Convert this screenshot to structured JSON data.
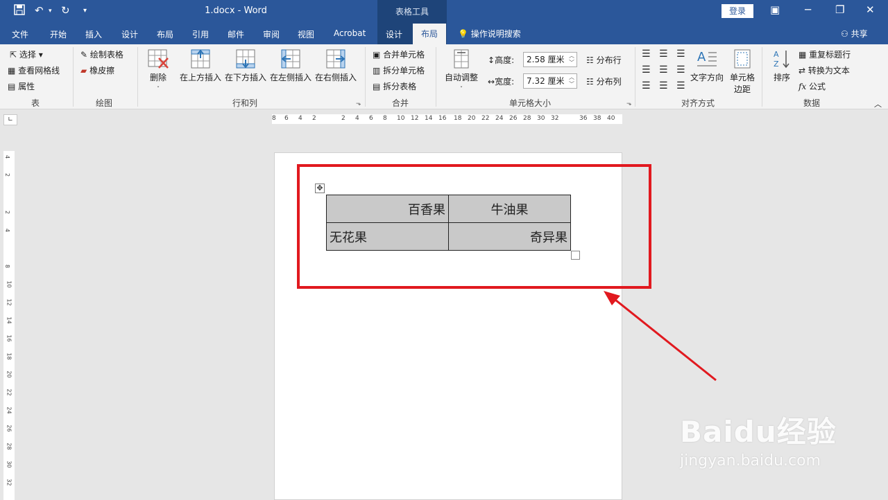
{
  "window": {
    "doc_title": "1.docx  -  Word",
    "context_tools": "表格工具",
    "login": "登录"
  },
  "tabs": [
    "文件",
    "开始",
    "插入",
    "设计",
    "布局",
    "引用",
    "邮件",
    "审阅",
    "视图",
    "Acrobat",
    "设计",
    "布局"
  ],
  "tell_me": "操作说明搜索",
  "share": "共享",
  "ribbon": {
    "table_group": {
      "label": "表",
      "select": "选择",
      "gridlines": "查看网格线",
      "properties": "属性"
    },
    "draw_group": {
      "label": "绘图",
      "draw_table": "绘制表格",
      "eraser": "橡皮擦"
    },
    "rows_group": {
      "label": "行和列",
      "delete": "删除",
      "insert_above": "在上方插入",
      "insert_below": "在下方插入",
      "insert_left": "在左侧插入",
      "insert_right": "在右侧插入"
    },
    "merge_group": {
      "label": "合并",
      "merge_cells": "合并单元格",
      "split_cells": "拆分单元格",
      "split_table": "拆分表格"
    },
    "cellsize_group": {
      "label": "单元格大小",
      "autofit": "自动调整",
      "height_label": "高度:",
      "height_value": "2.58 厘米",
      "width_label": "宽度:",
      "width_value": "7.32 厘米",
      "distribute_rows": "分布行",
      "distribute_cols": "分布列"
    },
    "align_group": {
      "label": "对齐方式",
      "text_direction": "文字方向",
      "cell_margins_1": "单元格",
      "cell_margins_2": "边距"
    },
    "data_group": {
      "label": "数据",
      "sort": "排序",
      "repeat_header": "重复标题行",
      "convert_text": "转换为文本",
      "formula": "公式"
    }
  },
  "ruler_h": [
    "8",
    "6",
    "4",
    "2",
    "2",
    "4",
    "6",
    "8",
    "10",
    "12",
    "14",
    "16",
    "18",
    "20",
    "22",
    "24",
    "26",
    "28",
    "30",
    "32",
    "36",
    "38",
    "40"
  ],
  "ruler_v": [
    "4",
    "2",
    "2",
    "4",
    "8",
    "10",
    "12",
    "14",
    "16",
    "18",
    "20",
    "22",
    "24",
    "26",
    "28",
    "30",
    "32"
  ],
  "table": {
    "rows": [
      [
        "百香果",
        "牛油果"
      ],
      [
        "无花果",
        "奇异果"
      ]
    ]
  },
  "watermark": {
    "main": "Baidu经验",
    "url": "jingyan.baidu.com"
  },
  "colors": {
    "title_bar": "#2b579a",
    "ribbon": "#f3f3f3",
    "highlight": "#e1191f",
    "cell_fill": "#c9c9c9"
  }
}
